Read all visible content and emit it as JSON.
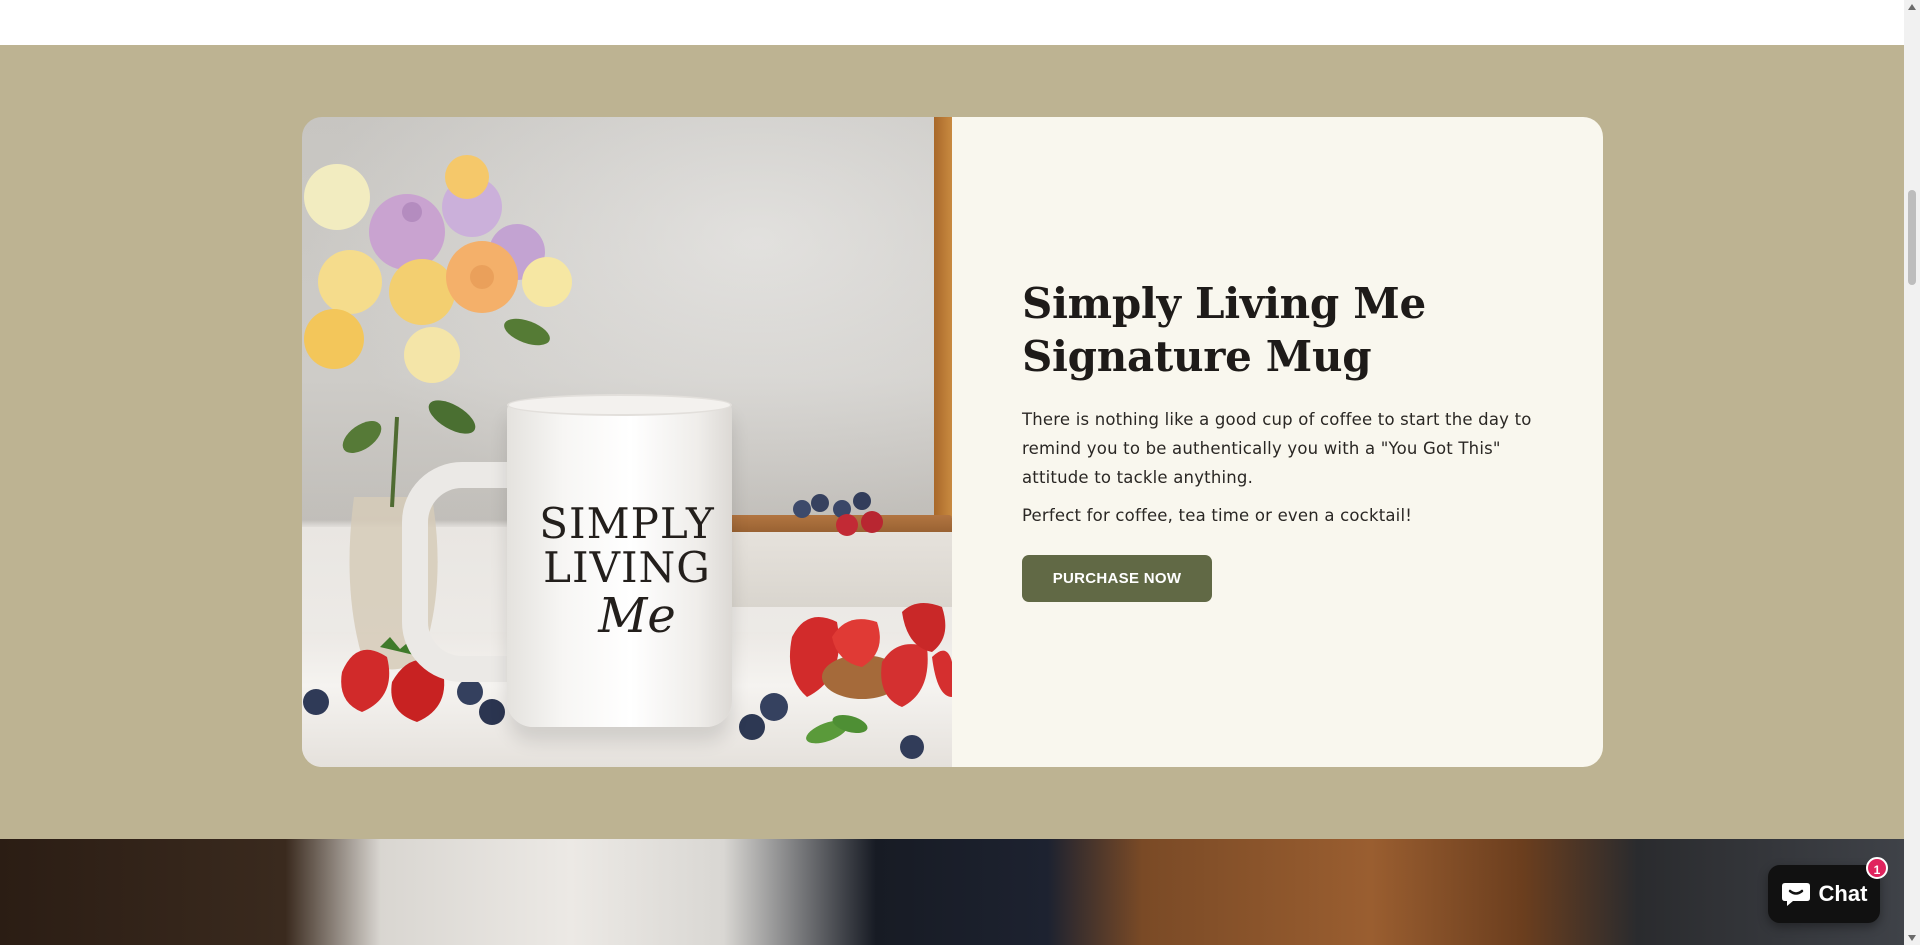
{
  "product": {
    "title_line1": "Simply Living Me",
    "title_line2": "Signature Mug",
    "description": "There is nothing like a good cup of coffee to start the day to remind you to be authentically you with a \"You Got This\" attitude to tackle anything.",
    "tagline": "Perfect for coffee, tea time or even a cocktail!",
    "button_label": "PURCHASE NOW",
    "mug_print": {
      "line1": "SIMPLY",
      "line2": "LIVING",
      "line3": "Me"
    }
  },
  "chat": {
    "label": "Chat",
    "badge_count": "1",
    "icon": "chat-bubble-icon"
  },
  "colors": {
    "section_background": "#bdb392",
    "panel_background": "#f9f7ee",
    "button_background": "#616945",
    "title_color": "#1e1b19",
    "chat_background": "#111111",
    "badge_color": "#e0245e"
  }
}
